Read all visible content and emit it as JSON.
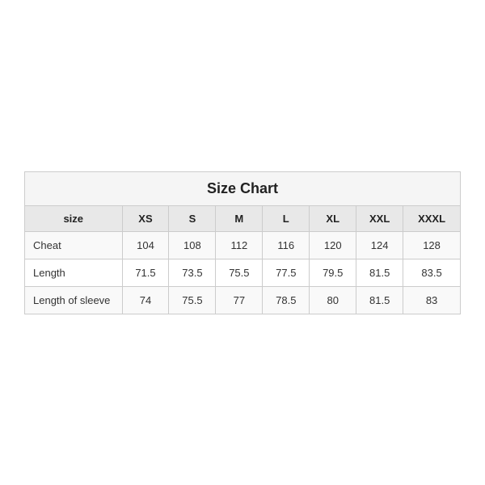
{
  "chart": {
    "title": "Size Chart",
    "columns": [
      "size",
      "XS",
      "S",
      "M",
      "L",
      "XL",
      "XXL",
      "XXXL"
    ],
    "rows": [
      {
        "label": "Cheat",
        "values": [
          "104",
          "108",
          "112",
          "116",
          "120",
          "124",
          "128"
        ]
      },
      {
        "label": "Length",
        "values": [
          "71.5",
          "73.5",
          "75.5",
          "77.5",
          "79.5",
          "81.5",
          "83.5"
        ]
      },
      {
        "label": "Length of sleeve",
        "values": [
          "74",
          "75.5",
          "77",
          "78.5",
          "80",
          "81.5",
          "83"
        ]
      }
    ]
  }
}
